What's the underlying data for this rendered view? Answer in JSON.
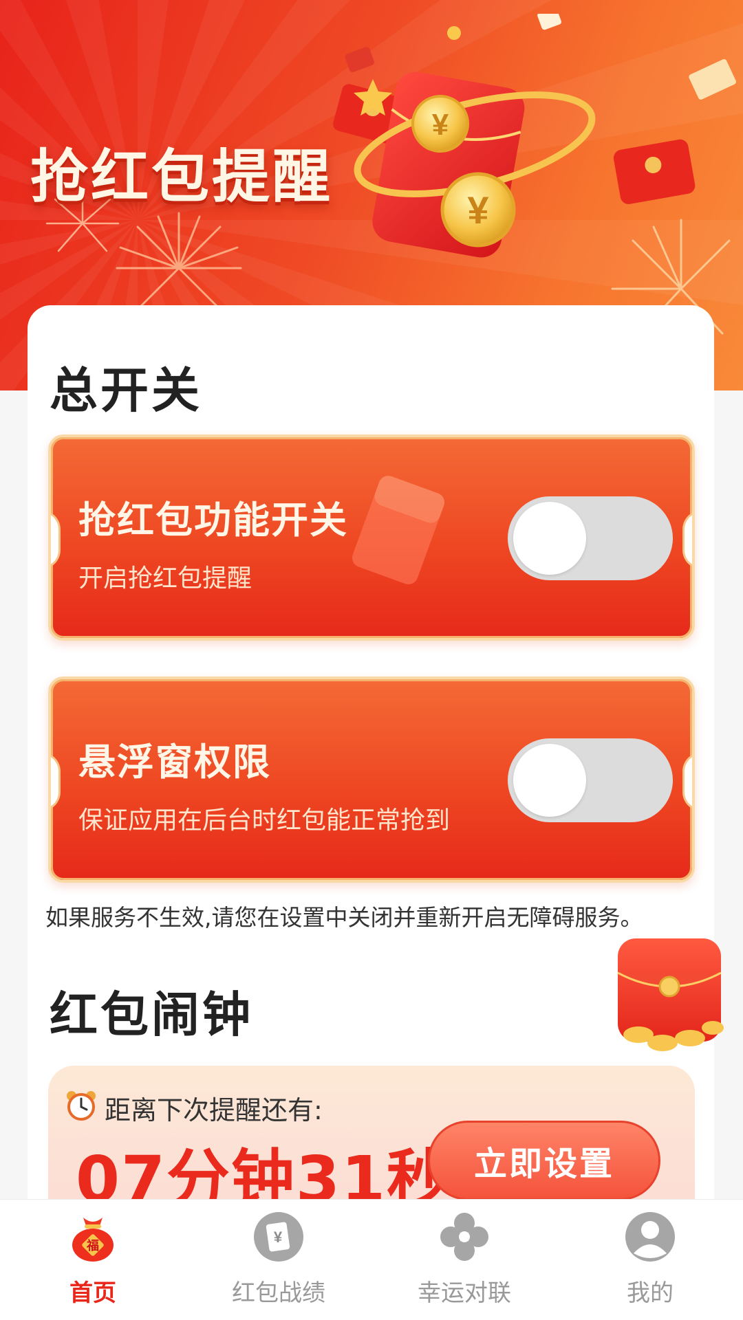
{
  "hero": {
    "title": "抢红包提醒"
  },
  "master_switch": {
    "section_title": "总开关",
    "items": [
      {
        "title": "抢红包功能开关",
        "desc": "开启抢红包提醒",
        "enabled": false
      },
      {
        "title": "悬浮窗权限",
        "desc": "保证应用在后台时红包能正常抢到",
        "enabled": false
      }
    ],
    "notice": "如果服务不生效,请您在设置中关闭并重新开启无障碍服务。"
  },
  "alarm": {
    "section_title": "红包闹钟",
    "label": "距离下次提醒还有:",
    "countdown": "07分钟31秒",
    "button": "立即设置"
  },
  "tabbar": {
    "items": [
      {
        "label": "首页",
        "icon": "lucky-bag-icon",
        "active": true
      },
      {
        "label": "红包战绩",
        "icon": "money-envelope-icon",
        "active": false
      },
      {
        "label": "幸运对联",
        "icon": "clover-icon",
        "active": false
      },
      {
        "label": "我的",
        "icon": "user-icon",
        "active": false
      }
    ]
  },
  "colors": {
    "primary_red": "#e8271a",
    "hero_orange": "#f98a3a",
    "toggle_off": "#dcdcdc"
  }
}
